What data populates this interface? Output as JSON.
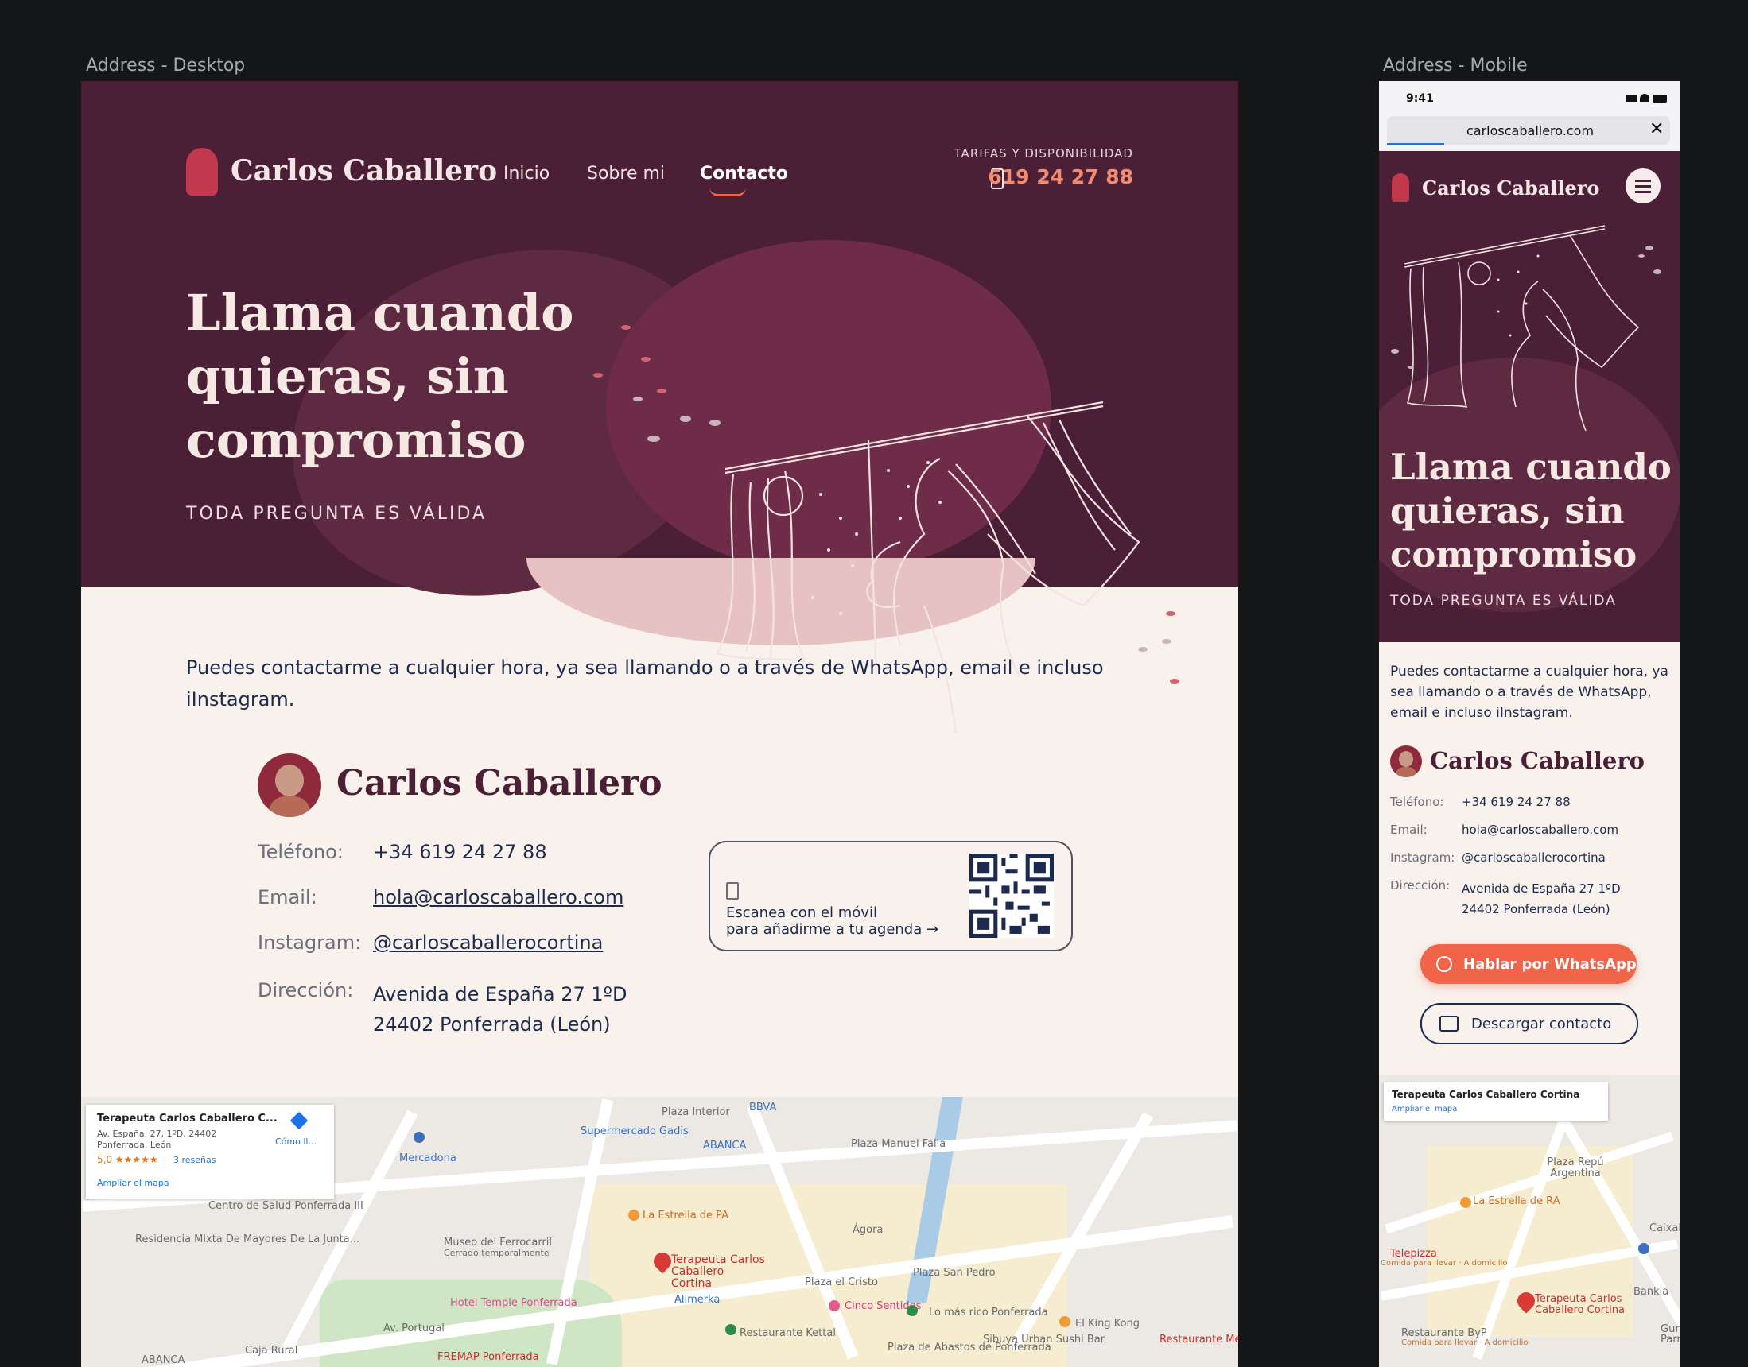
{
  "frames": {
    "desktop_label": "Address - Desktop",
    "mobile_label": "Address - Mobile"
  },
  "brand": {
    "name": "Carlos Caballero"
  },
  "nav": {
    "items": [
      "Inicio",
      "Sobre mi",
      "Contacto"
    ],
    "active": "Contacto"
  },
  "header_contact": {
    "label": "TARIFAS Y DISPONIBILIDAD",
    "phone": "619 24 27 88"
  },
  "hero": {
    "title_lines": [
      "Llama cuando",
      "quieras, sin",
      "compromiso"
    ],
    "subtitle": "TODA PREGUNTA ES VÁLIDA"
  },
  "intro": "Puedes contactarme a cualquier hora, ya sea llamando o a través de WhatsApp, email e incluso iInstagram.",
  "contact": {
    "name": "Carlos Caballero",
    "rows": [
      {
        "label": "Teléfono:",
        "value": "+34 619 24 27 88"
      },
      {
        "label": "Email:",
        "value": "hola@carloscaballero.com"
      },
      {
        "label": "Instagram:",
        "value": "@carloscaballerocortina"
      },
      {
        "label": "Dirección:",
        "value": "Avenida de España 27 1ºD",
        "value2": "24402 Ponferrada (León)"
      }
    ]
  },
  "qr": {
    "line1": "Escanea con el móvil",
    "line2": "para añadirme a tu agenda →"
  },
  "map_card": {
    "title": "Terapeuta Carlos Caballero C...",
    "address1": "Av. España, 27, 1ºD, 24402",
    "address2": "Ponferrada, León",
    "rating": "5,0 ★★★★★",
    "reviews": "3 reseñas",
    "directions": "Cómo ll...",
    "enlarge": "Ampliar el mapa"
  },
  "map_labels_desktop": [
    "Plaza Interior",
    "BBVA",
    "Supermercado Gadis",
    "ABANCA",
    "Plaza Manuel Falla",
    "Mercadona",
    "Centro de Salud Ponferrada III",
    "Residencia Mixta De Mayores De La Junta...",
    "Museo del Ferrocarril",
    "Cerrado temporalmente",
    "La Estrella de PA",
    "Ágora",
    "Terapeuta Carlos Caballero Cortina",
    "Plaza el Cristo",
    "Plaza San Pedro",
    "Hotel Temple Ponferrada",
    "Alimerka",
    "Cinco Sentidos",
    "Lo más rico Ponferrada",
    "El King Kong",
    "Restaurante Kettal",
    "Sibuya Urban Sushi Bar",
    "Plaza de Abastos de Ponferrada",
    "FREMAP Ponferrada",
    "Caja Rural",
    "ABANCA",
    "Av. Portugal",
    "Restaurante Me"
  ],
  "mobile": {
    "status_time": "9:41",
    "url": "carloscaballero.com",
    "contact_rows": [
      {
        "label": "Teléfono:",
        "value": "+34 619 24 27 88"
      },
      {
        "label": "Email:",
        "value": "hola@carloscaballero.com"
      },
      {
        "label": "Instagram:",
        "value": "@carloscaballerocortina"
      },
      {
        "label": "Dirección:",
        "value": "Avenida de España 27 1ºD",
        "value2": "24402 Ponferrada (León)"
      }
    ],
    "whatsapp_button": "Hablar por WhatsApp",
    "download_button": "Descargar contacto",
    "map_card": {
      "title": "Terapeuta Carlos Caballero Cortina",
      "enlarge": "Ampliar el mapa"
    },
    "map_labels": [
      "Plaza Repú Argentina",
      "La Estrella de RA",
      "CaixaB",
      "Telepizza",
      "Comida para llevar · A domicilio",
      "Bankia",
      "Terapeuta Carlos Caballero Cortina",
      "Restaurante ByP",
      "Comida para llevar · A domicilio",
      "Gund Parrilla"
    ]
  },
  "colors": {
    "brand_plum": "#4b2036",
    "accent_salmon": "#f28b70",
    "cream": "#f8f1ec",
    "whatsapp_orange": "#f0654a",
    "ink": "#1d2a4d"
  }
}
